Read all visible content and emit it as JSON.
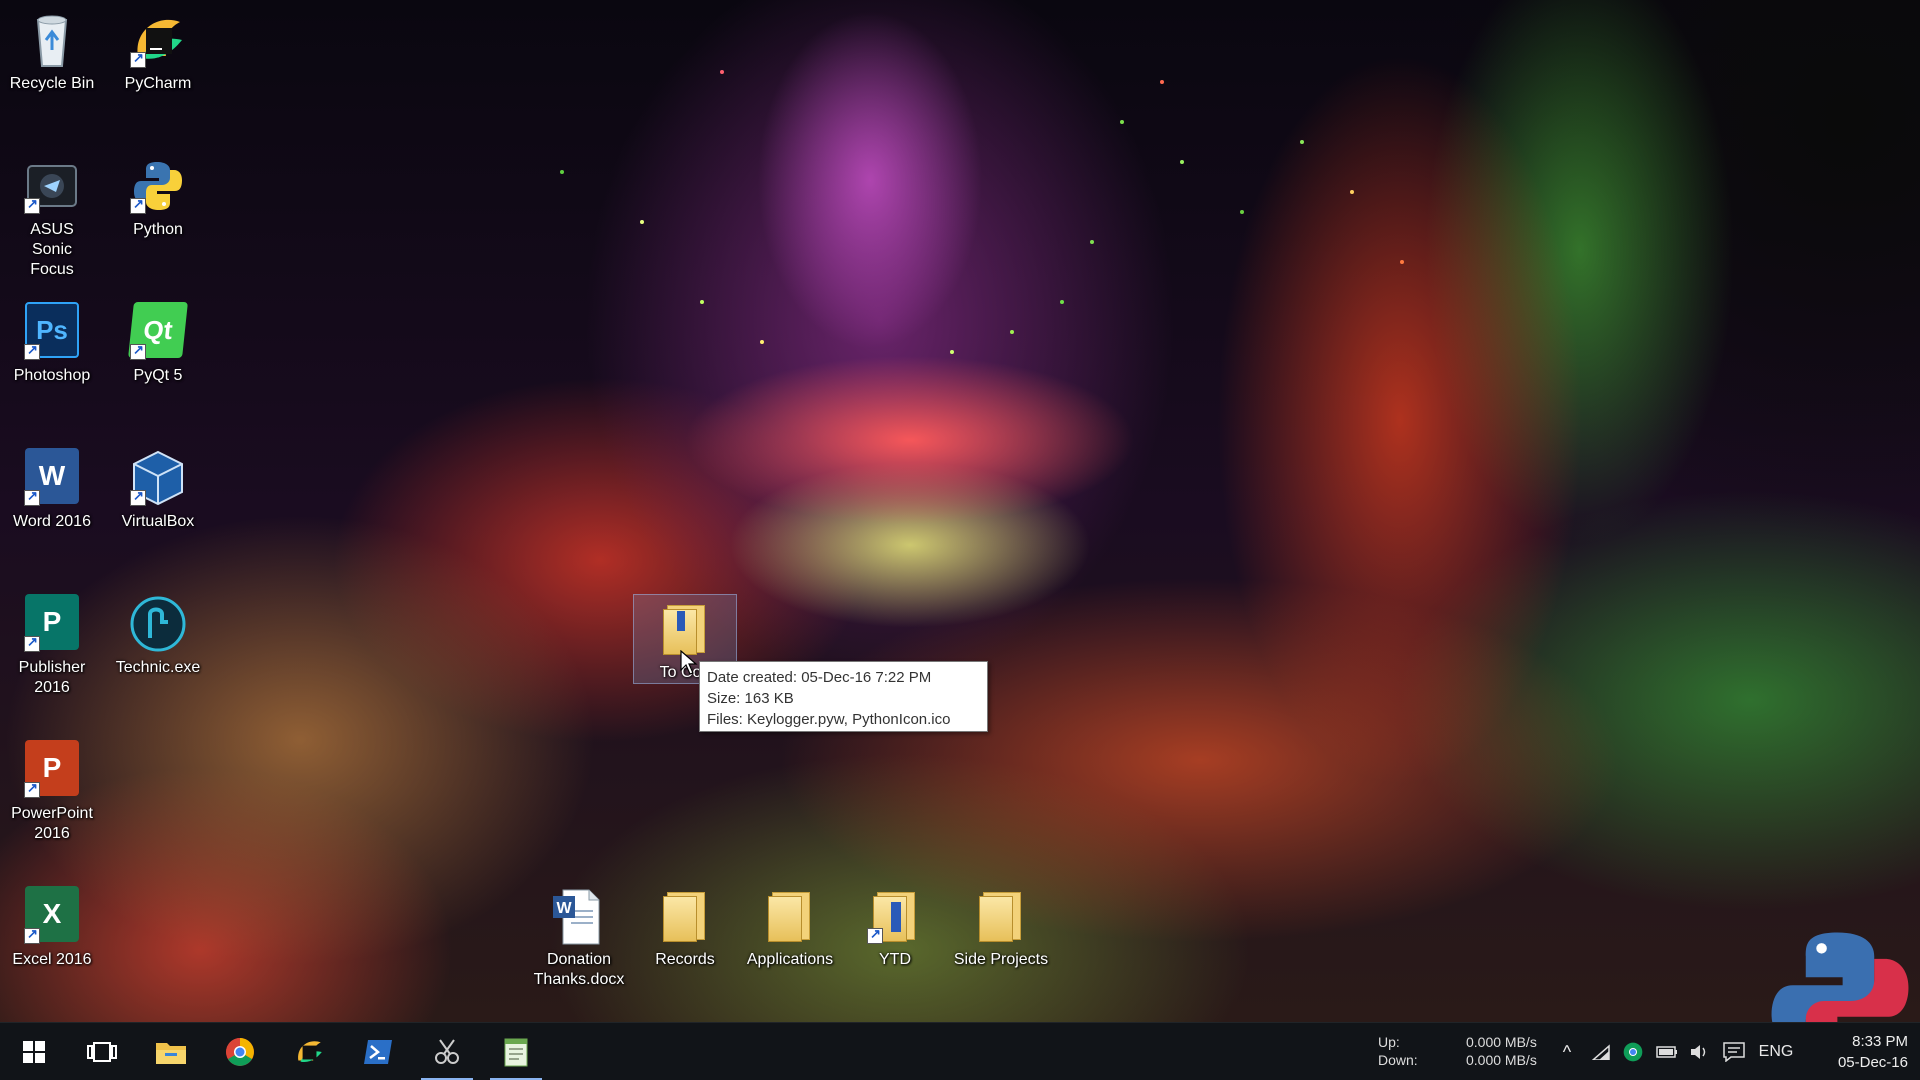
{
  "desktop": {
    "icons": [
      {
        "label": "Recycle Bin"
      },
      {
        "label": "PyCharm"
      },
      {
        "label": "ASUS Sonic Focus"
      },
      {
        "label": "Python"
      },
      {
        "label": "Photoshop",
        "glyph": "Ps"
      },
      {
        "label": "PyQt 5",
        "glyph": "Qt"
      },
      {
        "label": "Word 2016",
        "glyph": "W"
      },
      {
        "label": "VirtualBox"
      },
      {
        "label": "Publisher 2016",
        "glyph": "P"
      },
      {
        "label": "Technic.exe"
      },
      {
        "label": "PowerPoint 2016",
        "glyph": "P"
      },
      {
        "label": "Excel 2016",
        "glyph": "X"
      },
      {
        "label": "To Con"
      },
      {
        "label": "Donation Thanks.docx",
        "glyph": "W"
      },
      {
        "label": "Records"
      },
      {
        "label": "Applications"
      },
      {
        "label": "YTD"
      },
      {
        "label": "Side Projects"
      }
    ]
  },
  "tooltip": {
    "date_created": "Date created: 05-Dec-16 7:22 PM",
    "size": "Size: 163 KB",
    "files": "Files: Keylogger.pyw, PythonIcon.ico"
  },
  "taskbar": {
    "apps": [
      {
        "icon": "windows-start-icon"
      },
      {
        "icon": "task-view-icon"
      },
      {
        "icon": "file-explorer-icon"
      },
      {
        "icon": "chrome-icon"
      },
      {
        "icon": "pycharm-icon"
      },
      {
        "icon": "powershell-icon"
      },
      {
        "icon": "snipping-tool-icon"
      },
      {
        "icon": "notepad-icon"
      }
    ],
    "network": {
      "up_label": "Up:",
      "down_label": "Down:",
      "up_value": "0.000 MB/s",
      "down_value": "0.000 MB/s"
    },
    "tray": {
      "language": "ENG",
      "chevron": "^"
    },
    "clock": {
      "time": "8:33 PM",
      "date": "05-Dec-16"
    }
  },
  "colors": {
    "taskbar_bg": "#111418",
    "word_blue": "#2b5797",
    "excel_green": "#1e7145",
    "powerpoint_red": "#c43e1c",
    "publisher_teal": "#077568",
    "photoshop_blue": "#0a2e5c"
  }
}
